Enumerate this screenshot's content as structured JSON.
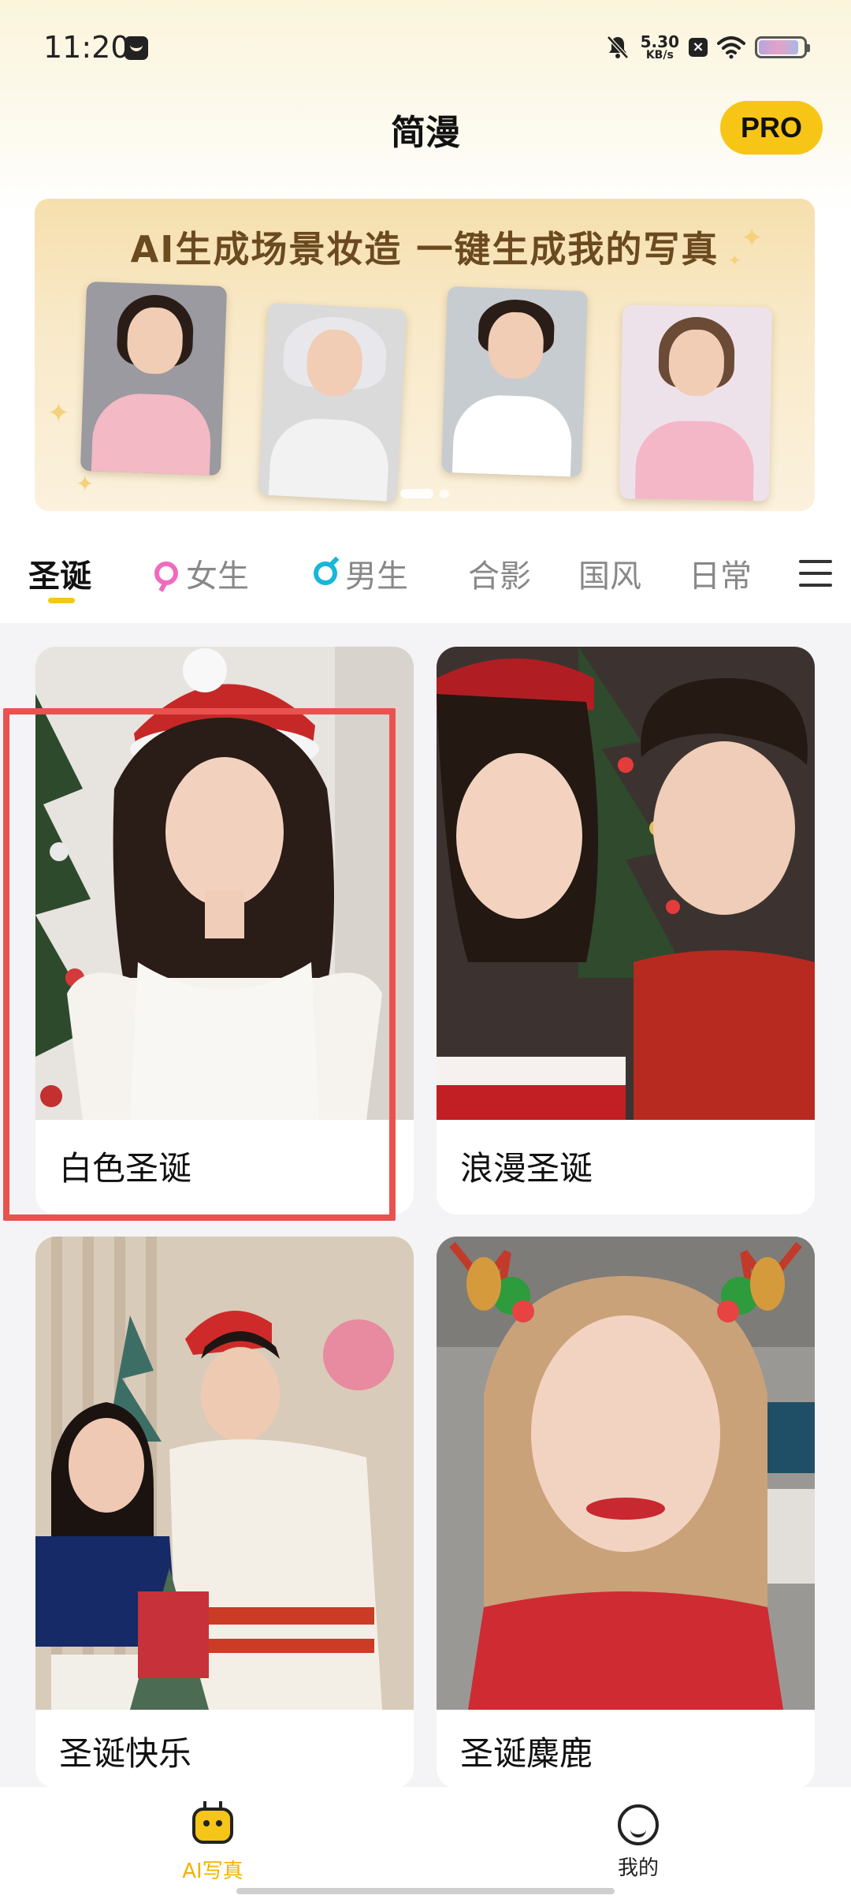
{
  "status_bar": {
    "time": "11:20",
    "net_speed_value": "5.30",
    "net_speed_unit": "KB/s",
    "x_badge": "×",
    "battery_level": 0.9
  },
  "header": {
    "title": "简漫",
    "pro_label": "PRO"
  },
  "banner": {
    "title": "AI生成场景妆造 一键生成我的写真",
    "slides_total": 2,
    "active_slide": 1,
    "accent_color": "#6b4a1f"
  },
  "tabs": [
    {
      "label": "圣诞",
      "active": true
    },
    {
      "label": "女生",
      "icon": "female-icon"
    },
    {
      "label": "男生",
      "icon": "male-icon"
    },
    {
      "label": "合影"
    },
    {
      "label": "国风"
    },
    {
      "label": "日常"
    }
  ],
  "cards": [
    {
      "label": "白色圣诞",
      "highlighted": true
    },
    {
      "label": "浪漫圣诞"
    },
    {
      "label": "圣诞快乐"
    },
    {
      "label": "圣诞麋鹿"
    }
  ],
  "bottom_nav": {
    "ai_photo_label": "AI写真",
    "mine_label": "我的",
    "active_color": "#f0b300"
  }
}
